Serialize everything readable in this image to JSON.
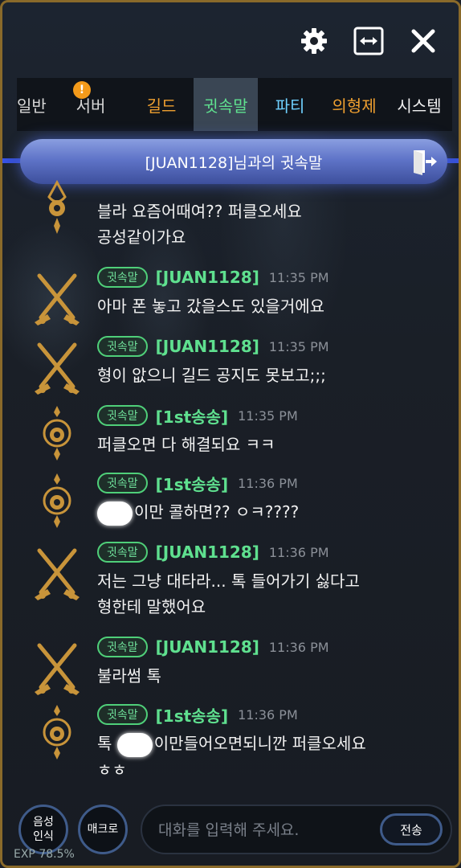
{
  "toolbar": {
    "settings_icon": "gear-icon",
    "resize_icon": "resize-horizontal-icon",
    "close_icon": "close-icon"
  },
  "tabs": [
    {
      "label": "일반",
      "badge": ""
    },
    {
      "label": "서버",
      "badge": "!"
    },
    {
      "label": "길드",
      "badge": ""
    },
    {
      "label": "귓속말",
      "badge": ""
    },
    {
      "label": "파티",
      "badge": ""
    },
    {
      "label": "의형제",
      "badge": ""
    },
    {
      "label": "시스템",
      "badge": ""
    }
  ],
  "whisper": {
    "title": "[JUAN1128]님과의 귓속말",
    "exit_icon": "exit-door-icon"
  },
  "messages": [
    {
      "tag": "",
      "name": "",
      "time": "",
      "lines": [
        "블라 요즘어때여?? 퍼클오세요",
        "공성같이가요"
      ],
      "avatar": "pendant-icon"
    },
    {
      "tag": "귓속말",
      "name": "[JUAN1128]",
      "time": "11:35 PM",
      "lines": [
        "아마 폰 놓고 갔을스도 있을거에요"
      ],
      "avatar": "crossed-swords-icon"
    },
    {
      "tag": "귓속말",
      "name": "[JUAN1128]",
      "time": "11:35 PM",
      "lines": [
        "형이 앖으니 길드 공지도 못보고;;;"
      ],
      "avatar": "crossed-swords-icon"
    },
    {
      "tag": "귓속말",
      "name": "[1st송송]",
      "time": "11:35 PM",
      "lines": [
        "퍼클오면 다 해결되요 ㅋㅋ"
      ],
      "avatar": "pendant-icon"
    },
    {
      "tag": "귓속말",
      "name": "[1st송송]",
      "time": "11:36 PM",
      "lines": [
        "이만 콜하면?? ㅇㅋ????"
      ],
      "avatar": "pendant-icon"
    },
    {
      "tag": "귓속말",
      "name": "[JUAN1128]",
      "time": "11:36 PM",
      "lines": [
        "저는 그냥 대타라... 톡 들어가기 싫다고",
        "형한테 말했어요"
      ],
      "avatar": "crossed-swords-icon"
    },
    {
      "tag": "귓속말",
      "name": "[JUAN1128]",
      "time": "11:36 PM",
      "lines": [
        "불라썸 톡"
      ],
      "avatar": "crossed-swords-icon"
    },
    {
      "tag": "귓속말",
      "name": "[1st송송]",
      "time": "11:36 PM",
      "lines": [
        "톡 이만들어오면되니깐 퍼클오세요",
        "ㅎㅎ"
      ],
      "avatar": "pendant-icon"
    }
  ],
  "bottom": {
    "voice_label_1": "음성",
    "voice_label_2": "인식",
    "macro_label": "매크로",
    "input_placeholder": "대화를 입력해 주세요.",
    "input_value": "",
    "send_label": "전송",
    "exp_text": "EXP 78.5%"
  },
  "colors": {
    "accent_green": "#5fe08f",
    "guild_orange": "#f0a030",
    "party_blue": "#6fd0ff",
    "frame_gold": "#8a6a2a"
  }
}
